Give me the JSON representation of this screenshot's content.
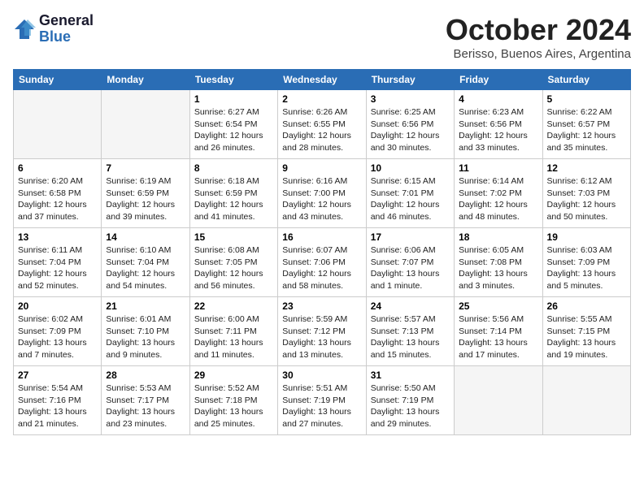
{
  "header": {
    "logo_general": "General",
    "logo_blue": "Blue",
    "month": "October 2024",
    "location": "Berisso, Buenos Aires, Argentina"
  },
  "days": [
    "Sunday",
    "Monday",
    "Tuesday",
    "Wednesday",
    "Thursday",
    "Friday",
    "Saturday"
  ],
  "weeks": [
    [
      {
        "day": "",
        "content": ""
      },
      {
        "day": "",
        "content": ""
      },
      {
        "day": "1",
        "content": "Sunrise: 6:27 AM\nSunset: 6:54 PM\nDaylight: 12 hours\nand 26 minutes."
      },
      {
        "day": "2",
        "content": "Sunrise: 6:26 AM\nSunset: 6:55 PM\nDaylight: 12 hours\nand 28 minutes."
      },
      {
        "day": "3",
        "content": "Sunrise: 6:25 AM\nSunset: 6:56 PM\nDaylight: 12 hours\nand 30 minutes."
      },
      {
        "day": "4",
        "content": "Sunrise: 6:23 AM\nSunset: 6:56 PM\nDaylight: 12 hours\nand 33 minutes."
      },
      {
        "day": "5",
        "content": "Sunrise: 6:22 AM\nSunset: 6:57 PM\nDaylight: 12 hours\nand 35 minutes."
      }
    ],
    [
      {
        "day": "6",
        "content": "Sunrise: 6:20 AM\nSunset: 6:58 PM\nDaylight: 12 hours\nand 37 minutes."
      },
      {
        "day": "7",
        "content": "Sunrise: 6:19 AM\nSunset: 6:59 PM\nDaylight: 12 hours\nand 39 minutes."
      },
      {
        "day": "8",
        "content": "Sunrise: 6:18 AM\nSunset: 6:59 PM\nDaylight: 12 hours\nand 41 minutes."
      },
      {
        "day": "9",
        "content": "Sunrise: 6:16 AM\nSunset: 7:00 PM\nDaylight: 12 hours\nand 43 minutes."
      },
      {
        "day": "10",
        "content": "Sunrise: 6:15 AM\nSunset: 7:01 PM\nDaylight: 12 hours\nand 46 minutes."
      },
      {
        "day": "11",
        "content": "Sunrise: 6:14 AM\nSunset: 7:02 PM\nDaylight: 12 hours\nand 48 minutes."
      },
      {
        "day": "12",
        "content": "Sunrise: 6:12 AM\nSunset: 7:03 PM\nDaylight: 12 hours\nand 50 minutes."
      }
    ],
    [
      {
        "day": "13",
        "content": "Sunrise: 6:11 AM\nSunset: 7:04 PM\nDaylight: 12 hours\nand 52 minutes."
      },
      {
        "day": "14",
        "content": "Sunrise: 6:10 AM\nSunset: 7:04 PM\nDaylight: 12 hours\nand 54 minutes."
      },
      {
        "day": "15",
        "content": "Sunrise: 6:08 AM\nSunset: 7:05 PM\nDaylight: 12 hours\nand 56 minutes."
      },
      {
        "day": "16",
        "content": "Sunrise: 6:07 AM\nSunset: 7:06 PM\nDaylight: 12 hours\nand 58 minutes."
      },
      {
        "day": "17",
        "content": "Sunrise: 6:06 AM\nSunset: 7:07 PM\nDaylight: 13 hours\nand 1 minute."
      },
      {
        "day": "18",
        "content": "Sunrise: 6:05 AM\nSunset: 7:08 PM\nDaylight: 13 hours\nand 3 minutes."
      },
      {
        "day": "19",
        "content": "Sunrise: 6:03 AM\nSunset: 7:09 PM\nDaylight: 13 hours\nand 5 minutes."
      }
    ],
    [
      {
        "day": "20",
        "content": "Sunrise: 6:02 AM\nSunset: 7:09 PM\nDaylight: 13 hours\nand 7 minutes."
      },
      {
        "day": "21",
        "content": "Sunrise: 6:01 AM\nSunset: 7:10 PM\nDaylight: 13 hours\nand 9 minutes."
      },
      {
        "day": "22",
        "content": "Sunrise: 6:00 AM\nSunset: 7:11 PM\nDaylight: 13 hours\nand 11 minutes."
      },
      {
        "day": "23",
        "content": "Sunrise: 5:59 AM\nSunset: 7:12 PM\nDaylight: 13 hours\nand 13 minutes."
      },
      {
        "day": "24",
        "content": "Sunrise: 5:57 AM\nSunset: 7:13 PM\nDaylight: 13 hours\nand 15 minutes."
      },
      {
        "day": "25",
        "content": "Sunrise: 5:56 AM\nSunset: 7:14 PM\nDaylight: 13 hours\nand 17 minutes."
      },
      {
        "day": "26",
        "content": "Sunrise: 5:55 AM\nSunset: 7:15 PM\nDaylight: 13 hours\nand 19 minutes."
      }
    ],
    [
      {
        "day": "27",
        "content": "Sunrise: 5:54 AM\nSunset: 7:16 PM\nDaylight: 13 hours\nand 21 minutes."
      },
      {
        "day": "28",
        "content": "Sunrise: 5:53 AM\nSunset: 7:17 PM\nDaylight: 13 hours\nand 23 minutes."
      },
      {
        "day": "29",
        "content": "Sunrise: 5:52 AM\nSunset: 7:18 PM\nDaylight: 13 hours\nand 25 minutes."
      },
      {
        "day": "30",
        "content": "Sunrise: 5:51 AM\nSunset: 7:19 PM\nDaylight: 13 hours\nand 27 minutes."
      },
      {
        "day": "31",
        "content": "Sunrise: 5:50 AM\nSunset: 7:19 PM\nDaylight: 13 hours\nand 29 minutes."
      },
      {
        "day": "",
        "content": ""
      },
      {
        "day": "",
        "content": ""
      }
    ]
  ]
}
